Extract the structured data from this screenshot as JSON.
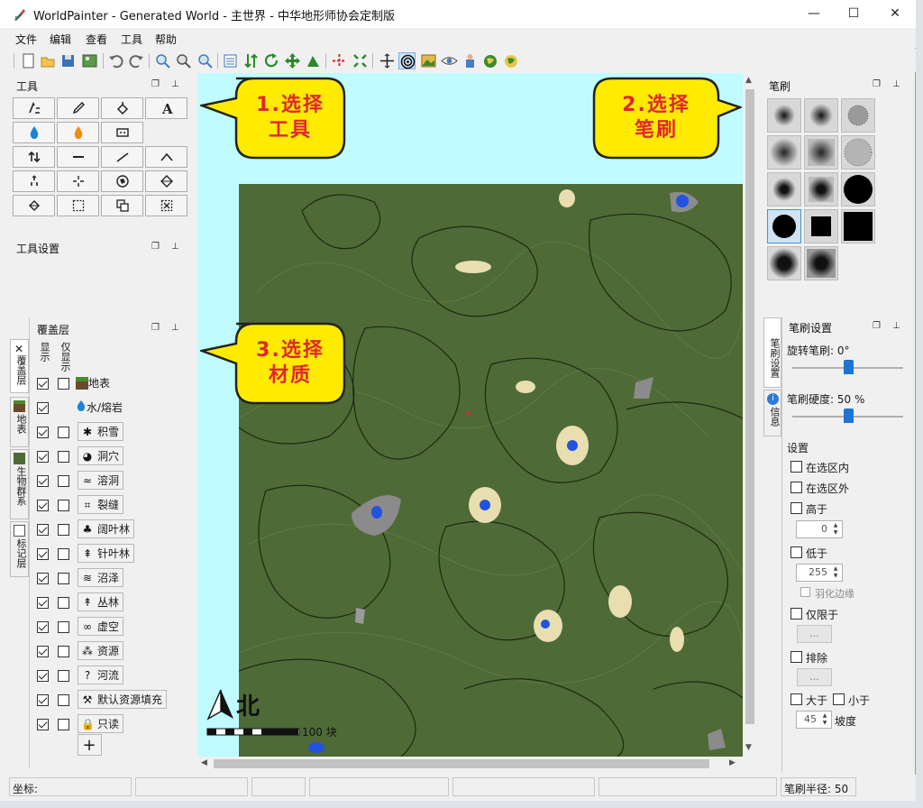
{
  "window": {
    "title": "WorldPainter - Generated World - 主世界 - 中华地形师协会定制版",
    "controls": {
      "minimize": "—",
      "maximize": "☐",
      "close": "✕"
    }
  },
  "menu": [
    "文件",
    "编辑",
    "查看",
    "工具",
    "帮助"
  ],
  "panels": {
    "tools_title": "工具",
    "tool_settings_title": "工具设置",
    "layers_title": "覆盖层",
    "brush_title": "笔刷",
    "brush_settings_title": "笔刷设置"
  },
  "left_tabs": [
    "覆盖层",
    "地表",
    "生物群系",
    "标记层"
  ],
  "layers": {
    "col_show": "显示",
    "col_solo": "仅显示",
    "items": [
      {
        "label": "地表",
        "icon": "grass-block-icon",
        "show": true,
        "solo": false,
        "button": false
      },
      {
        "label": "水/熔岩",
        "icon": "water-drop-icon",
        "show": true,
        "solo": null,
        "button": false
      },
      {
        "label": "积雪",
        "icon": "snowflake-icon",
        "show": true,
        "solo": false,
        "button": true
      },
      {
        "label": "洞穴",
        "icon": "cave-icon",
        "show": true,
        "solo": false,
        "button": true
      },
      {
        "label": "溶洞",
        "icon": "cavern-icon",
        "show": true,
        "solo": false,
        "button": true
      },
      {
        "label": "裂缝",
        "icon": "chasm-icon",
        "show": true,
        "solo": false,
        "button": true
      },
      {
        "label": "阔叶林",
        "icon": "deciduous-tree-icon",
        "show": true,
        "solo": false,
        "button": true
      },
      {
        "label": "针叶林",
        "icon": "pine-tree-icon",
        "show": true,
        "solo": false,
        "button": true
      },
      {
        "label": "沼泽",
        "icon": "swamp-icon",
        "show": true,
        "solo": false,
        "button": true
      },
      {
        "label": "丛林",
        "icon": "jungle-icon",
        "show": true,
        "solo": false,
        "button": true
      },
      {
        "label": "虚空",
        "icon": "void-icon",
        "show": true,
        "solo": false,
        "button": true
      },
      {
        "label": "资源",
        "icon": "resources-icon",
        "show": true,
        "solo": false,
        "button": true
      },
      {
        "label": "河流",
        "icon": "question-icon",
        "show": true,
        "solo": false,
        "button": true
      },
      {
        "label": "默认资源填充",
        "icon": "pickaxe-icon",
        "show": true,
        "solo": false,
        "button": true
      },
      {
        "label": "只读",
        "icon": "lock-icon",
        "show": true,
        "solo": false,
        "button": true
      }
    ],
    "add_label": "+"
  },
  "callouts": {
    "c1": "1.选择\n工具",
    "c2": "2.选择\n笔刷",
    "c3": "3.选择\n材质"
  },
  "map": {
    "north_label": "北",
    "scale_label": "100 块"
  },
  "right_tabs": [
    "笔刷设置",
    "信息"
  ],
  "brush_settings": {
    "rotation_label": "旋转笔刷: 0°",
    "rotation_value": 0,
    "hardness_label": "笔刷硬度: 50 %",
    "hardness_value": 0.5,
    "settings_heading": "设置",
    "in_selection": "在选区内",
    "out_selection": "在选区外",
    "above": "高于",
    "above_value": "0",
    "below": "低于",
    "below_value": "255",
    "feather": "羽化边缘",
    "only_on": "仅限于",
    "only_on_button": "...",
    "except": "排除",
    "except_button": "...",
    "greater": "大于",
    "less": "小于",
    "slope_value": "45",
    "slope_label": "坡度"
  },
  "status": {
    "coords": "坐标:",
    "brush_radius": "笔刷半径: 50"
  },
  "colors": {
    "canvas_bg": "#c0fcff",
    "terrain": "#4e6a36",
    "callout_fill": "#ffeb00",
    "callout_text": "#e0262f",
    "selection_accent": "#1e74d0"
  }
}
